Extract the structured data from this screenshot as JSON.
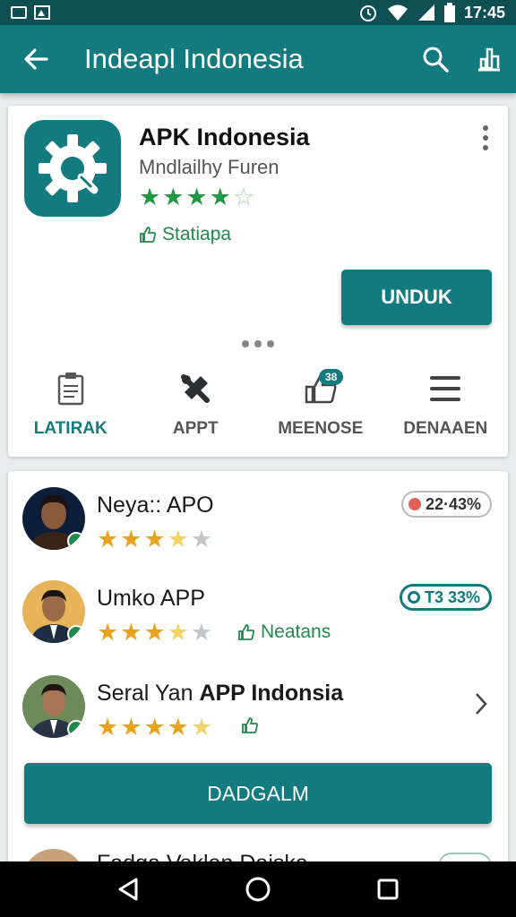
{
  "status_bar": {
    "time": "17:45",
    "icons": [
      "notification-box-icon",
      "notification-image-icon",
      "alarm-icon",
      "wifi-icon",
      "signal-icon",
      "battery-icon"
    ]
  },
  "app_bar": {
    "title": "Indeapl Indonesia",
    "icons": [
      "back-arrow-icon",
      "search-icon",
      "share-chart-icon"
    ],
    "color": "#137b7f"
  },
  "app_card": {
    "name": "APK Indonesia",
    "developer": "Mndlailhy Furen",
    "rating": 4.5,
    "rating_max": 5,
    "tag": "Statiapa",
    "install_button": "UNDUK",
    "tabs": [
      {
        "label": "LATIRAK",
        "icon": "clipboard-icon",
        "active": true
      },
      {
        "label": "APPT",
        "icon": "tools-icon",
        "active": false
      },
      {
        "label": "MEENOSE",
        "icon": "thumbs-up-icon",
        "badge": "38",
        "active": false
      },
      {
        "label": "DENAAEN",
        "icon": "menu-icon",
        "active": false
      }
    ]
  },
  "list": {
    "items": [
      {
        "name": "Neya:: APO",
        "rating": 3.5,
        "pill": "22·43%",
        "pill_style": "red"
      },
      {
        "name": "Umko APP",
        "rating": 3.5,
        "tag": "Neatans",
        "pill": "T3 33%",
        "pill_style": "green"
      },
      {
        "name_plain": "Seral Yan ",
        "name_bold": "APP Indonsia",
        "rating": 5,
        "tag_icon": "thumbs-up-icon",
        "chevron": true
      }
    ],
    "button": "DADGALM",
    "partial_item": {
      "name": "Fadga Vaklan Daiska"
    }
  },
  "nav_bar": {
    "icons": [
      "back-triangle-icon",
      "home-circle-icon",
      "recents-square-icon"
    ]
  }
}
